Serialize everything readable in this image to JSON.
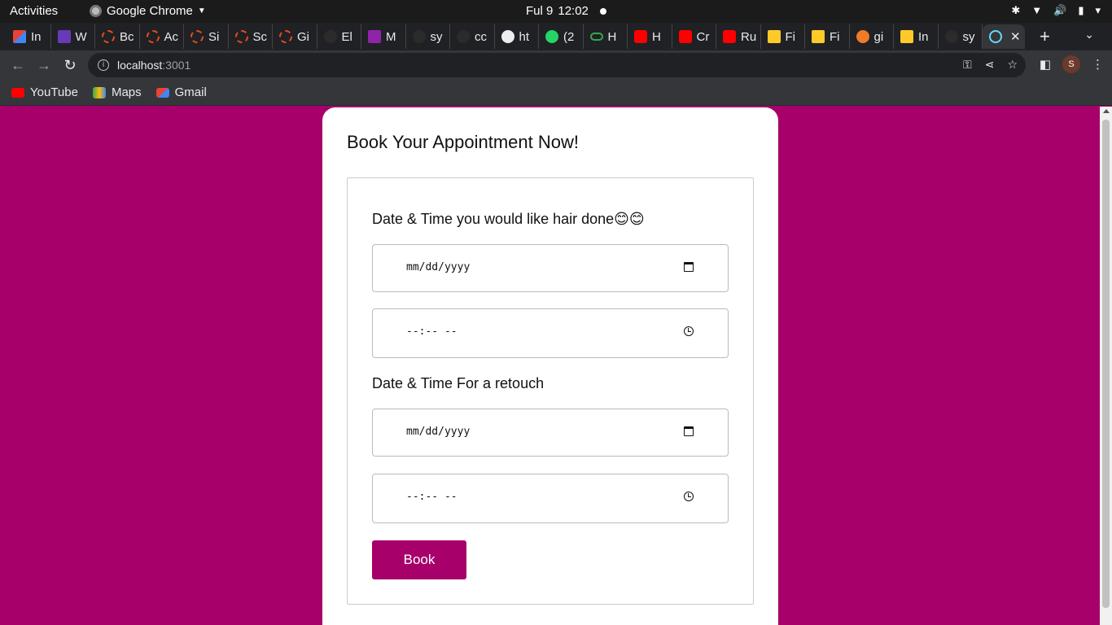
{
  "system_bar": {
    "activities": "Activities",
    "app_name": "Google Chrome",
    "day": "Ful 9",
    "time": "12:02"
  },
  "tabs": [
    {
      "label": "In",
      "icon": "gmail-icon"
    },
    {
      "label": "W",
      "icon": "list-icon"
    },
    {
      "label": "Bc",
      "icon": "loading-ring-icon"
    },
    {
      "label": "Ac",
      "icon": "loading-ring-icon"
    },
    {
      "label": "Si",
      "icon": "loading-ring-icon"
    },
    {
      "label": "Sc",
      "icon": "loading-ring-icon"
    },
    {
      "label": "Gi",
      "icon": "loading-ring-icon"
    },
    {
      "label": "El",
      "icon": "github-icon"
    },
    {
      "label": "M",
      "icon": "calendar-icon"
    },
    {
      "label": "sy",
      "icon": "github-icon"
    },
    {
      "label": "cc",
      "icon": "github-icon"
    },
    {
      "label": "ht",
      "icon": "globe-icon"
    },
    {
      "label": "(2",
      "icon": "whatsapp-icon"
    },
    {
      "label": "H",
      "icon": "link-icon"
    },
    {
      "label": "H",
      "icon": "youtube-icon"
    },
    {
      "label": "Cr",
      "icon": "youtube-icon"
    },
    {
      "label": "Ru",
      "icon": "youtube-icon"
    },
    {
      "label": "Fi",
      "icon": "firebase-icon"
    },
    {
      "label": "Fi",
      "icon": "firebase-icon"
    },
    {
      "label": "gi",
      "icon": "ask-icon"
    },
    {
      "label": "In",
      "icon": "firebase-icon"
    },
    {
      "label": "sy",
      "icon": "github-icon"
    }
  ],
  "address_bar": {
    "host": "localhost",
    "port": ":3001"
  },
  "bookmarks": [
    {
      "label": "YouTube",
      "icon": "youtube-icon"
    },
    {
      "label": "Maps",
      "icon": "maps-icon"
    },
    {
      "label": "Gmail",
      "icon": "gmail-icon"
    }
  ],
  "page": {
    "title": "Book Your Appointment Now!",
    "section1_label": "Date & Time you would like hair done😊😊",
    "section2_label": "Date & Time For a retouch",
    "date_placeholder": "mm/dd/yyyy",
    "time_placeholder": "--:-- --",
    "book_button": "Book"
  },
  "colors": {
    "page_background": "#a8006a",
    "button": "#a8006a"
  }
}
